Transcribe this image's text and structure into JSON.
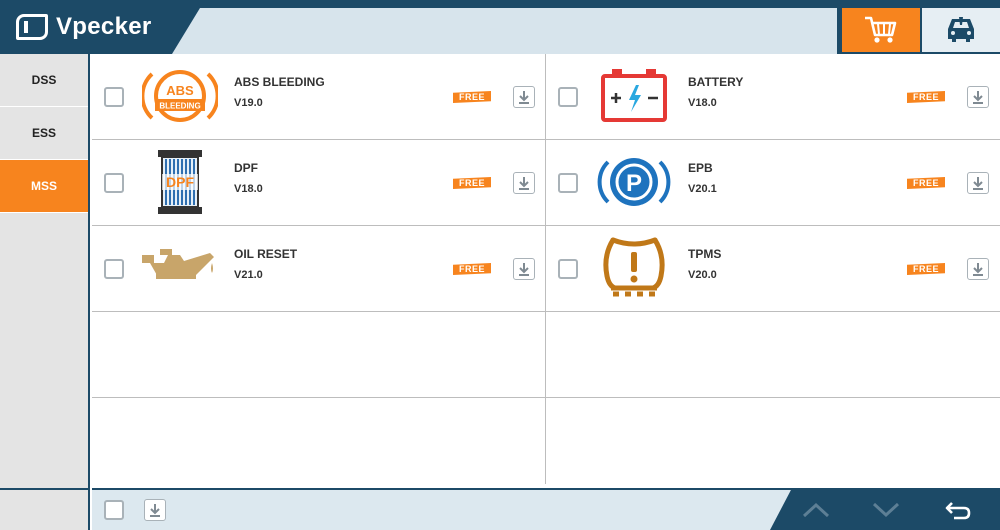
{
  "app": {
    "title": "Vpecker"
  },
  "header": {
    "cart_icon": "cart-icon",
    "car_icon": "car-service-icon"
  },
  "sidebar": {
    "items": [
      {
        "label": "DSS",
        "active": false
      },
      {
        "label": "ESS",
        "active": false
      },
      {
        "label": "MSS",
        "active": true
      }
    ]
  },
  "functions": [
    {
      "name": "ABS BLEEDING",
      "version": "V19.0",
      "badge": "FREE",
      "icon": "abs-bleeding-icon",
      "icon_text_top": "ABS",
      "icon_text_bottom": "BLEEDING"
    },
    {
      "name": "BATTERY",
      "version": "V18.0",
      "badge": "FREE",
      "icon": "battery-icon"
    },
    {
      "name": "DPF",
      "version": "V18.0",
      "badge": "FREE",
      "icon": "dpf-filter-icon",
      "icon_text": "DPF"
    },
    {
      "name": "EPB",
      "version": "V20.1",
      "badge": "FREE",
      "icon": "parking-brake-icon",
      "icon_text": "P"
    },
    {
      "name": "OIL RESET",
      "version": "V21.0",
      "badge": "FREE",
      "icon": "oil-can-icon"
    },
    {
      "name": "TPMS",
      "version": "V20.0",
      "badge": "FREE",
      "icon": "tire-pressure-icon"
    }
  ],
  "colors": {
    "accent": "#f7841e",
    "brand": "#1c4a67",
    "abs": "#f7841e",
    "battery": "#e53935",
    "epb": "#1e73be",
    "oil": "#c8a56a",
    "tpms": "#c07818"
  }
}
